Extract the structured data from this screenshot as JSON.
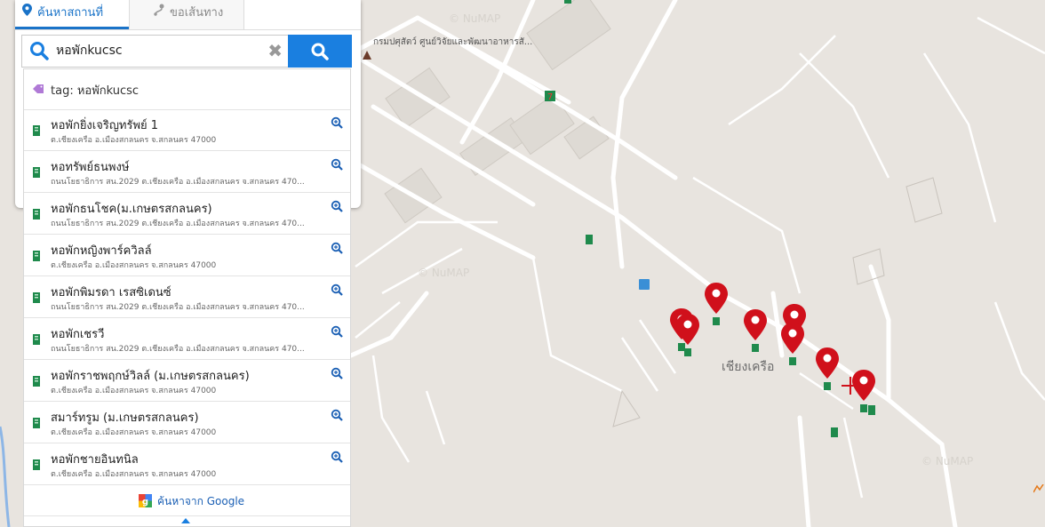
{
  "tabs": {
    "search_label": "ค้นหาสถานที่",
    "route_label": "ขอเส้นทาง"
  },
  "search": {
    "value": "หอพักkucsc",
    "placeholder": ""
  },
  "tag_suggestion": "tag: หอพักkucsc",
  "results": [
    {
      "name": "หอพักยิ่งเจริญทรัพย์ 1",
      "address": "ต.เชียงเครือ อ.เมืองสกลนคร จ.สกลนคร 47000"
    },
    {
      "name": "หอทรัพย์ธนพงษ์",
      "address": "ถนนโยธาธิการ สน.2029 ต.เชียงเครือ อ.เมืองสกลนคร จ.สกลนคร 470..."
    },
    {
      "name": "หอพักธนโชค(ม.เกษตรสกลนคร)",
      "address": "ถนนโยธาธิการ สน.2029 ต.เชียงเครือ อ.เมืองสกลนคร จ.สกลนคร 470..."
    },
    {
      "name": "หอพักหญิงพาร์ควิลล์",
      "address": "ต.เชียงเครือ อ.เมืองสกลนคร จ.สกลนคร 47000"
    },
    {
      "name": "หอพักพิมรดา เรสซิเดนซ์",
      "address": "ถนนโยธาธิการ สน.2029 ต.เชียงเครือ อ.เมืองสกลนคร จ.สกลนคร 470..."
    },
    {
      "name": "หอพักเชรวี",
      "address": "ถนนโยธาธิการ สน.2029 ต.เชียงเครือ อ.เมืองสกลนคร จ.สกลนคร 470..."
    },
    {
      "name": "หอพักราชพฤกษ์วิลล์ (ม.เกษตรสกลนคร)",
      "address": "ต.เชียงเครือ อ.เมืองสกลนคร จ.สกลนคร 47000"
    },
    {
      "name": "สมาร์ทรูม (ม.เกษตรสกลนคร)",
      "address": "ต.เชียงเครือ อ.เมืองสกลนคร จ.สกลนคร 47000"
    },
    {
      "name": "หอพักชายอินทนิล",
      "address": "ต.เชียงเครือ อ.เมืองสกลนคร จ.สกลนคร 47000"
    }
  ],
  "google_search_label": "ค้นหาจาก Google",
  "map": {
    "place_label": "กรมปศุสัตว์ ศูนย์วิจัยและพัฒนาอาหารสั...",
    "district_label": "เชียงเครือ",
    "watermark": "© NuMAP"
  },
  "colors": {
    "accent": "#1a7fe0",
    "marker": "#d0101b",
    "building_icon": "#1f8a4c",
    "map_background": "#e8e4df",
    "road": "#ffffff"
  }
}
